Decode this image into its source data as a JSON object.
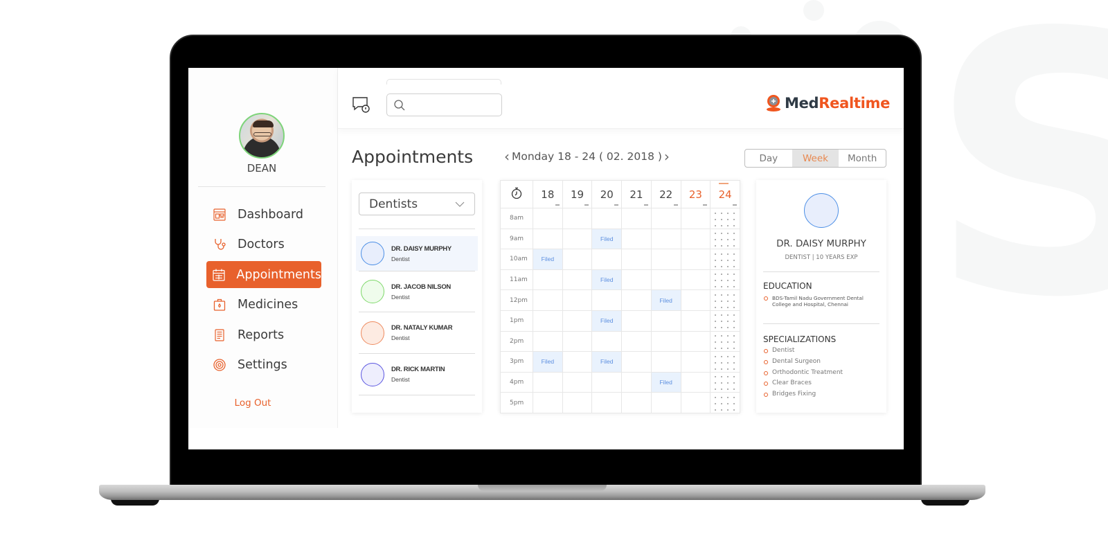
{
  "app": {
    "brand_part1": "Med",
    "brand_part2": "Realtime",
    "brand_icon": "location-pin-plus-icon",
    "accent_color": "#e8612c"
  },
  "user": {
    "name": "DEAN",
    "avatar": "user-photo"
  },
  "sidebar": {
    "items": [
      {
        "label": "Dashboard",
        "icon": "dashboard-icon",
        "active": false
      },
      {
        "label": "Doctors",
        "icon": "stethoscope-icon",
        "active": false
      },
      {
        "label": "Appointments",
        "icon": "calendar-icon",
        "active": true
      },
      {
        "label": "Medicines",
        "icon": "medicine-kit-icon",
        "active": false
      },
      {
        "label": "Reports",
        "icon": "report-icon",
        "active": false
      },
      {
        "label": "Settings",
        "icon": "settings-icon",
        "active": false
      }
    ],
    "logout_label": "Log Out"
  },
  "topbar": {
    "chat_icon": "chat-notification-icon",
    "search": {
      "placeholder": "",
      "value": "",
      "icon": "search-icon"
    }
  },
  "main": {
    "title": "Appointments",
    "week_range": "Monday 18 - 24 ( 02. 2018 )",
    "prev_icon": "chevron-left-icon",
    "next_icon": "chevron-right-icon",
    "view_options": [
      {
        "label": "Day",
        "active": false
      },
      {
        "label": "Week",
        "active": true
      },
      {
        "label": "Month",
        "active": false
      }
    ]
  },
  "doctor_list": {
    "filter_value": "Dentists",
    "doctors": [
      {
        "name": "DR. DAISY MURPHY",
        "role": "Dentist",
        "color": "#4c8fe6",
        "fill": "#e8eefc",
        "selected": true
      },
      {
        "name": "DR. JACOB NILSON",
        "role": "Dentist",
        "color": "#7ed86a",
        "fill": "#effcec",
        "selected": false
      },
      {
        "name": "DR. NATALY KUMAR",
        "role": "Dentist",
        "color": "#ee8a5e",
        "fill": "#fdebe2",
        "selected": false
      },
      {
        "name": "DR. RICK MARTIN",
        "role": "Dentist",
        "color": "#5a55e0",
        "fill": "#eeeefd",
        "selected": false
      }
    ]
  },
  "calendar": {
    "days": [
      {
        "num": "18",
        "weekend": false,
        "today": false
      },
      {
        "num": "19",
        "weekend": false,
        "today": false
      },
      {
        "num": "20",
        "weekend": false,
        "today": false
      },
      {
        "num": "21",
        "weekend": false,
        "today": false
      },
      {
        "num": "22",
        "weekend": false,
        "today": false
      },
      {
        "num": "23",
        "weekend": true,
        "today": false
      },
      {
        "num": "24",
        "weekend": true,
        "today": true
      }
    ],
    "times": [
      "8am",
      "9am",
      "10am",
      "11am",
      "12pm",
      "1pm",
      "2pm",
      "3pm",
      "4pm",
      "5pm"
    ],
    "filed_label": "Filed",
    "filed_slots": [
      {
        "time": "9am",
        "day": "20"
      },
      {
        "time": "10am",
        "day": "18"
      },
      {
        "time": "11am",
        "day": "20"
      },
      {
        "time": "12pm",
        "day": "22"
      },
      {
        "time": "1pm",
        "day": "20"
      },
      {
        "time": "3pm",
        "day": "18"
      },
      {
        "time": "3pm",
        "day": "20"
      },
      {
        "time": "4pm",
        "day": "22"
      }
    ]
  },
  "doctor_detail": {
    "name": "DR. DAISY MURPHY",
    "subtitle": "DENTIST | 10 YEARS EXP",
    "education_heading": "EDUCATION",
    "education": [
      "BDS-Tamil Nadu Government Dental College and Hospital, Chennai"
    ],
    "specializations_heading": "SPECIALIZATIONS",
    "specializations": [
      "Dentist",
      "Dental Surgeon",
      "Orthodontic Treatment",
      "Clear Braces",
      "Bridges Fixing"
    ]
  }
}
